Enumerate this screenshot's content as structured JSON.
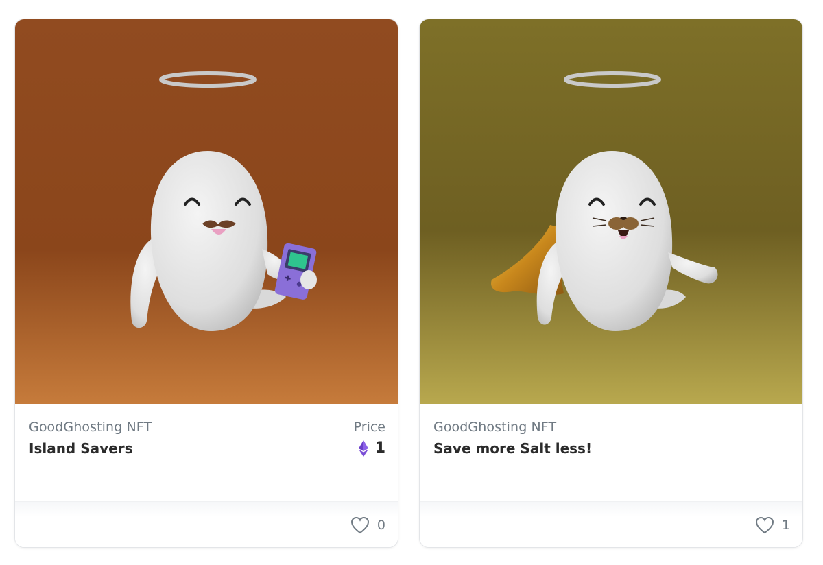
{
  "colors": {
    "card1_bg_top": "#8f4a1e",
    "card1_bg_bottom": "#c27836",
    "card2_bg_top": "#7a6a24",
    "card2_bg_bottom": "#b8a74c",
    "muted_text": "#707a83",
    "title_text": "#2b2b2b",
    "eth_purple": "#7b4fd6"
  },
  "cards": [
    {
      "collection": "GoodGhosting NFT",
      "name": "Island Savers",
      "price_label": "Price",
      "price_value": "1",
      "price_icon": "ethereum-icon",
      "like_icon": "heart-icon",
      "likes": "0"
    },
    {
      "collection": "GoodGhosting NFT",
      "name": "Save more Salt less!",
      "like_icon": "heart-icon",
      "likes": "1"
    }
  ]
}
